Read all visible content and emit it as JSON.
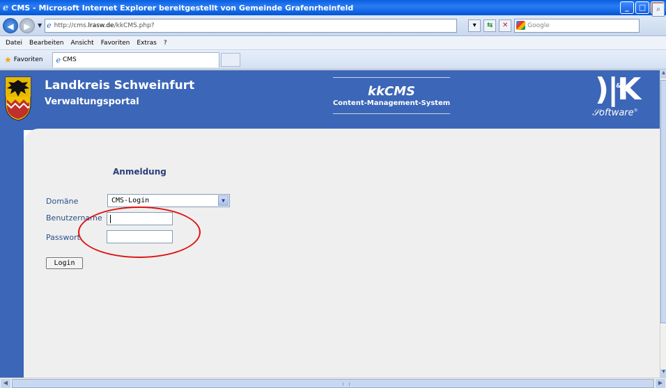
{
  "window": {
    "title": "CMS - Microsoft Internet Explorer bereitgestellt von Gemeinde Grafenrheinfeld"
  },
  "addressbar": {
    "url_prefix": "http://cms.",
    "url_host": "lrasw.de",
    "url_suffix": "/kkCMS.php?",
    "search_placeholder": "Google"
  },
  "menu": {
    "items": [
      "Datei",
      "Bearbeiten",
      "Ansicht",
      "Favoriten",
      "Extras",
      "?"
    ]
  },
  "favorites": {
    "label": "Favoriten",
    "tab_label": "CMS"
  },
  "banner": {
    "org_name": "Landkreis Schweinfurt",
    "org_sub": "Verwaltungsportal",
    "cms_title": "kkCMS",
    "cms_subtitle": "Content-Management-System",
    "logo_text": "K&K",
    "logo_sub": "Software"
  },
  "login": {
    "title": "Anmeldung",
    "domain_label": "Domäne",
    "domain_value": "CMS-Login",
    "username_label": "Benutzername",
    "password_label": "Passwort",
    "button_label": "Login"
  },
  "colors": {
    "banner_blue": "#3c66b7",
    "label_blue": "#2a4f8e",
    "annotation_red": "#e01010"
  }
}
